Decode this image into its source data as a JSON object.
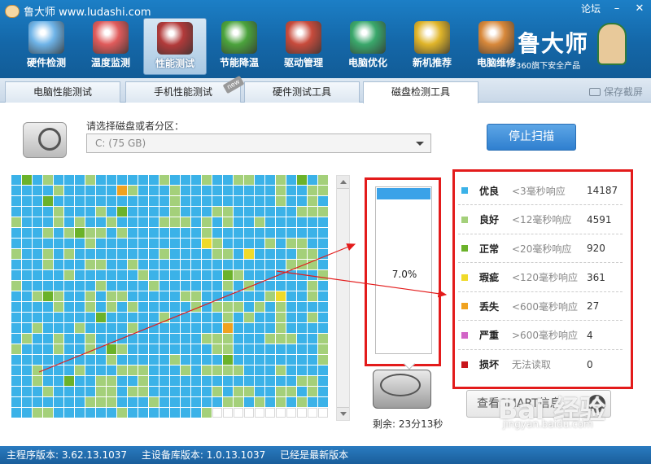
{
  "app": {
    "title": "鲁大师 www.ludashi.com",
    "forum_label": "论坛"
  },
  "nav": {
    "items": [
      {
        "label": "硬件检测",
        "icon": "monitor-magnifier-icon",
        "color": "#6fb4e8"
      },
      {
        "label": "温度监测",
        "icon": "thermometer-icon",
        "color": "#e05b5b"
      },
      {
        "label": "性能测试",
        "icon": "speedometer-icon",
        "color": "#b23a3a",
        "active": true
      },
      {
        "label": "节能降温",
        "icon": "clover-icon",
        "color": "#4ba33c"
      },
      {
        "label": "驱动管理",
        "icon": "toolbox-icon",
        "color": "#c84b3c"
      },
      {
        "label": "电脑优化",
        "icon": "screen-check-icon",
        "color": "#3aa86b"
      },
      {
        "label": "新机推荐",
        "icon": "laptop-badge-icon",
        "color": "#e0b52a"
      },
      {
        "label": "电脑维修",
        "icon": "house-icon",
        "color": "#d8883a"
      }
    ]
  },
  "brand": {
    "name": "鲁大师",
    "subtitle": "360旗下安全产品"
  },
  "tabs": [
    {
      "label": "电脑性能测试"
    },
    {
      "label": "手机性能测试",
      "badge": "new"
    },
    {
      "label": "硬件测试工具"
    },
    {
      "label": "磁盘检测工具",
      "active": true
    }
  ],
  "screenshot_button": "保存截屏",
  "disk_select": {
    "label": "请选择磁盘或者分区：",
    "value": "C:  (75 GB)"
  },
  "stop_button": "停止扫描",
  "progress": {
    "percent": 7.0,
    "text": "7.0%",
    "remaining": "剩余: 23分13秒"
  },
  "legend": [
    {
      "name": "优良",
      "desc": "<3毫秒响应",
      "count": "14187",
      "color": "#3bb2e8"
    },
    {
      "name": "良好",
      "desc": "<12毫秒响应",
      "count": "4591",
      "color": "#a4d07a"
    },
    {
      "name": "正常",
      "desc": "<20毫秒响应",
      "count": "920",
      "color": "#6bb22a"
    },
    {
      "name": "瑕疵",
      "desc": "<120毫秒响应",
      "count": "361",
      "color": "#f0da2a"
    },
    {
      "name": "丢失",
      "desc": "<600毫秒响应",
      "count": "27",
      "color": "#f0a21f"
    },
    {
      "name": "严重",
      "desc": ">600毫秒响应",
      "count": "4",
      "color": "#d265c7"
    },
    {
      "name": "损坏",
      "desc": "无法读取",
      "count": "0",
      "color": "#c8161c"
    }
  ],
  "smart_button": "查看SMART信息",
  "status": {
    "main_version": "主程序版本: 3.62.13.1037",
    "db_version": "主设备库版本: 1.0.13.1037",
    "latest": "已经是最新版本"
  },
  "watermark": {
    "text": "Bai 经验",
    "url": "jingyan.baidu.com"
  },
  "grid": {
    "columns": 30,
    "filled_cells": 679,
    "total_cells": 690,
    "colors": {
      "blue": "#3bb2e8",
      "green": "#a4d07a",
      "dark_green": "#6bb22a",
      "yellow": "#f0da2a",
      "orange": "#f0a21f",
      "empty": "#ffffff"
    }
  }
}
